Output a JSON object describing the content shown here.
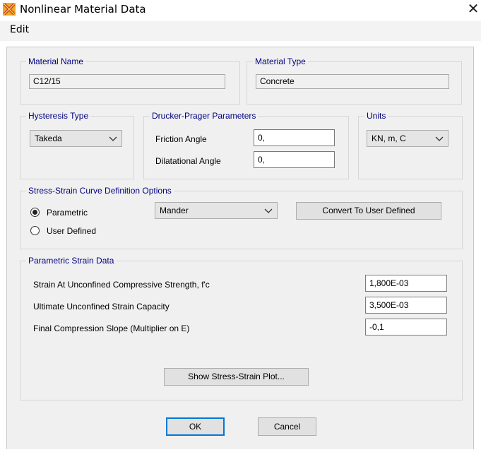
{
  "window": {
    "title": "Nonlinear Material Data",
    "close_symbol": "✕"
  },
  "menu": {
    "edit_label": "Edit"
  },
  "material_name": {
    "title": "Material Name",
    "value": "C12/15"
  },
  "material_type": {
    "title": "Material Type",
    "value": "Concrete"
  },
  "hysteresis": {
    "title": "Hysteresis Type",
    "selected": "Takeda"
  },
  "drucker_prager": {
    "title": "Drucker-Prager Parameters",
    "friction_label": "Friction Angle",
    "friction_value": "0,",
    "dilatational_label": "Dilatational Angle",
    "dilatational_value": "0,"
  },
  "units": {
    "title": "Units",
    "selected": "KN, m, C"
  },
  "curve_options": {
    "title": "Stress-Strain Curve Definition Options",
    "parametric_label": "Parametric",
    "user_defined_label": "User Defined",
    "selected_option": "Parametric",
    "model_selected": "Mander",
    "convert_button": "Convert To User Defined"
  },
  "strain_data": {
    "title": "Parametric Strain Data",
    "rows": [
      {
        "label": "Strain At Unconfined Compressive Strength, f'c",
        "value": "1,800E-03"
      },
      {
        "label": "Ultimate Unconfined Strain Capacity",
        "value": "3,500E-03"
      },
      {
        "label": "Final Compression Slope (Multiplier on E)",
        "value": "-0,1"
      }
    ],
    "plot_button": "Show Stress-Strain Plot..."
  },
  "buttons": {
    "ok": "OK",
    "cancel": "Cancel"
  },
  "colors": {
    "group_title": "#000080",
    "dialog_bg": "#f0f0f0",
    "focus_border": "#0078d7"
  }
}
